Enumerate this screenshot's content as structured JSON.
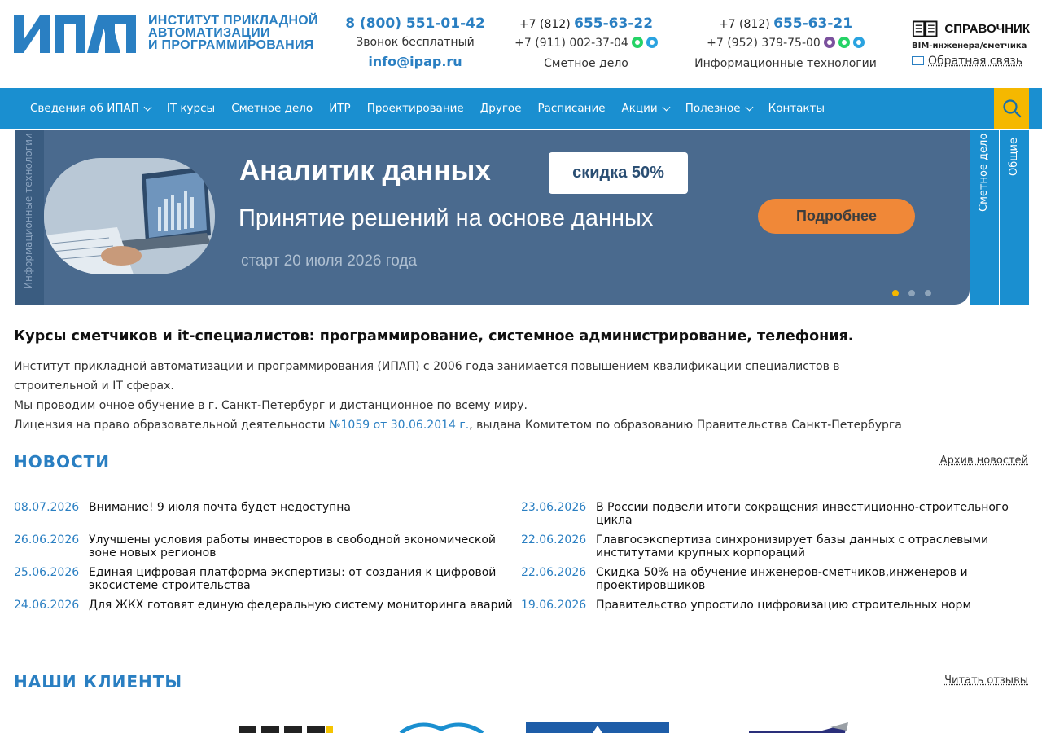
{
  "header": {
    "logo_text": "ИПАП",
    "logo_sub": [
      "ИНСТИТУТ ПРИКЛАДНОЙ",
      "АВТОМАТИЗАЦИИ",
      "И ПРОГРАММИРОВАНИЯ"
    ],
    "contact1": {
      "phone": "8 (800) 551-01-42",
      "note": "Звонок бесплатный",
      "email": "info@ipap.ru"
    },
    "contact2": {
      "phone_prefix": "+7 (812) ",
      "phone_main": "655-63-22",
      "phone2": "+7 (911) 002-37-04",
      "note": "Сметное дело"
    },
    "contact3": {
      "phone_prefix": "+7 (812) ",
      "phone_main": "655-63-21",
      "phone2": "+7 (952) 379-75-00",
      "note": "Информационные технологии"
    },
    "spravka": {
      "title": "СПРАВОЧНИК",
      "sub": "BIM-инженера/сметчика",
      "feedback": "Обратная связь"
    }
  },
  "nav": {
    "items": [
      {
        "label": "Сведения об ИПАП",
        "dropdown": true
      },
      {
        "label": "IT курсы",
        "dropdown": false
      },
      {
        "label": "Сметное дело",
        "dropdown": false
      },
      {
        "label": "ИТР",
        "dropdown": false
      },
      {
        "label": "Проектирование",
        "dropdown": false
      },
      {
        "label": "Другое",
        "dropdown": false
      },
      {
        "label": "Расписание",
        "dropdown": false
      },
      {
        "label": "Акции",
        "dropdown": true
      },
      {
        "label": "Полезное",
        "dropdown": true
      },
      {
        "label": "Контакты",
        "dropdown": false
      }
    ]
  },
  "banner": {
    "side_label": "Информационные технологии",
    "title": "Аналитик данных",
    "badge": "скидка 50%",
    "subtitle": "Принятие решений на основе данных",
    "button": "Подробнее",
    "date": "старт 20 июля 2026 года",
    "tab1": "Сметное дело",
    "tab2": "Общие",
    "active_slide": 1,
    "slide_count": 3
  },
  "intro": {
    "title": "Курсы сметчиков и it-специалистов: программирование, системное администрирование, телефония.",
    "p1": "Институт прикладной автоматизации и программирования (ИПАП) с 2006 года занимается повышением квалификации специалистов в строительной и IT сферах.",
    "p2": "Мы проводим очное обучение в г. Санкт-Петербург и дистанционное по всему миру.",
    "p3_before": "Лицензия на право образовательной деятельности ",
    "p3_link": "№1059 от 30.06.2014 г.",
    "p3_after": ", выдана Комитетом по образованию Правительства Санкт-Петербурга"
  },
  "news": {
    "title": "НОВОСТИ",
    "archive": "Архив новостей",
    "left": [
      {
        "date": "08.07.2026",
        "text": "Внимание! 9 июля почта будет недоступна"
      },
      {
        "date": "26.06.2026",
        "text": "Улучшены условия работы инвесторов в свободной экономической зоне новых регионов"
      },
      {
        "date": "25.06.2026",
        "text": "Единая цифровая платформа экспертизы: от создания к цифровой экосистеме строительства"
      },
      {
        "date": "24.06.2026",
        "text": "Для ЖКХ готовят единую федеральную систему мониторинга аварий"
      }
    ],
    "right": [
      {
        "date": "23.06.2026",
        "text": "В России подвели итоги сокращения инвестиционно-строительного цикла"
      },
      {
        "date": "22.06.2026",
        "text": "Главгосэкспертиза синхронизирует базы данных с отраслевыми институтами крупных корпораций"
      },
      {
        "date": "22.06.2026",
        "text": "Скидка 50% на обучение инженеров-сметчиков,инженеров и проектировщиков"
      },
      {
        "date": "19.06.2026",
        "text": "Правительство упростило цифровизацию строительных норм"
      }
    ]
  },
  "clients": {
    "title": "НАШИ КЛИЕНТЫ",
    "reviews": "Читать отзывы"
  },
  "colors": {
    "brand_blue": "#2a7fc2",
    "nav_blue": "#1a8fd0",
    "search_yellow": "#f5b800",
    "banner_bg": "#4a6a8e",
    "banner_button": "#f08838"
  }
}
